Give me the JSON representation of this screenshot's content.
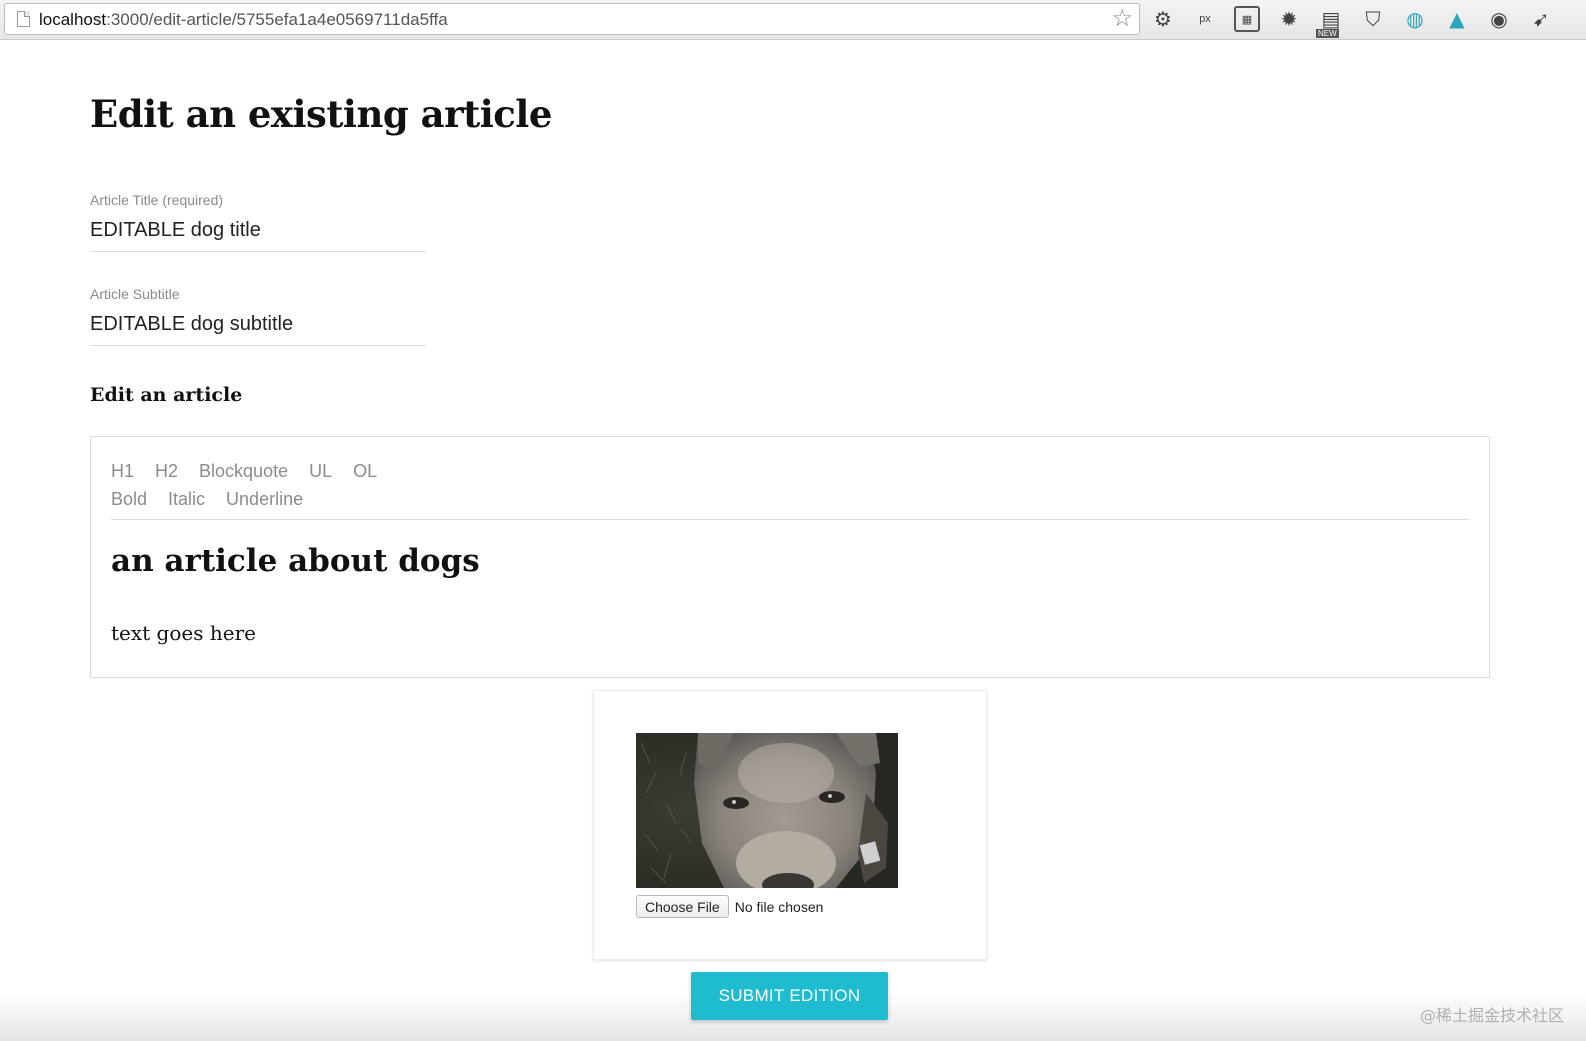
{
  "browser": {
    "url_host": "localhost",
    "url_path": ":3000/edit-article/5755efa1a4e0569711da5ffa",
    "extension_icons": [
      "gear-icon",
      "px-ruler-icon",
      "film-icon",
      "bug-icon",
      "calendar-new-icon",
      "pocket-icon",
      "globe-icon",
      "angular-icon",
      "earth-icon",
      "bird-icon"
    ],
    "new_badge": "NEW",
    "px_label": "px"
  },
  "page": {
    "title": "Edit an existing article",
    "title_field": {
      "label": "Article Title (required)",
      "value": "EDITABLE dog title"
    },
    "subtitle_field": {
      "label": "Article Subtitle",
      "value": "EDITABLE dog subtitle"
    },
    "editor_heading": "Edit an article",
    "toolbar": {
      "block_styles": [
        "H1",
        "H2",
        "Blockquote",
        "UL",
        "OL"
      ],
      "inline_styles": [
        "Bold",
        "Italic",
        "Underline"
      ]
    },
    "content": {
      "heading": "an article about dogs",
      "paragraph": "text goes here"
    },
    "image_upload": {
      "button_label": "Choose File",
      "status": "No file chosen"
    },
    "submit_label": "SUBMIT EDITION"
  },
  "watermark": "@稀土掘金技术社区",
  "colors": {
    "accent": "#1fbcd0",
    "toolbar_text": "#8c8c8c",
    "label_text": "#8a8a8a"
  }
}
